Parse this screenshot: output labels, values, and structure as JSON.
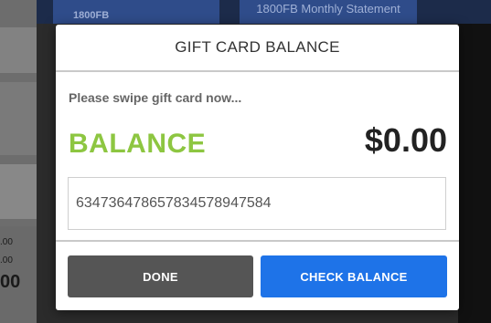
{
  "background": {
    "tile_left_label": "1800FB",
    "tile_right_label": "1800FB Monthly Statement",
    "left_numbers": [
      ".00",
      ".00",
      "00"
    ]
  },
  "modal": {
    "title": "GIFT CARD BALANCE",
    "prompt": "Please swipe gift card now...",
    "balance_label": "BALANCE",
    "balance_value": "$0.00",
    "card_number_value": "634736478657834578947584",
    "buttons": {
      "done_label": "DONE",
      "check_balance_label": "CHECK BALANCE"
    }
  },
  "colors": {
    "balance_label": "#8dc641",
    "primary_button": "#1e73e8",
    "secondary_button": "#555555"
  }
}
